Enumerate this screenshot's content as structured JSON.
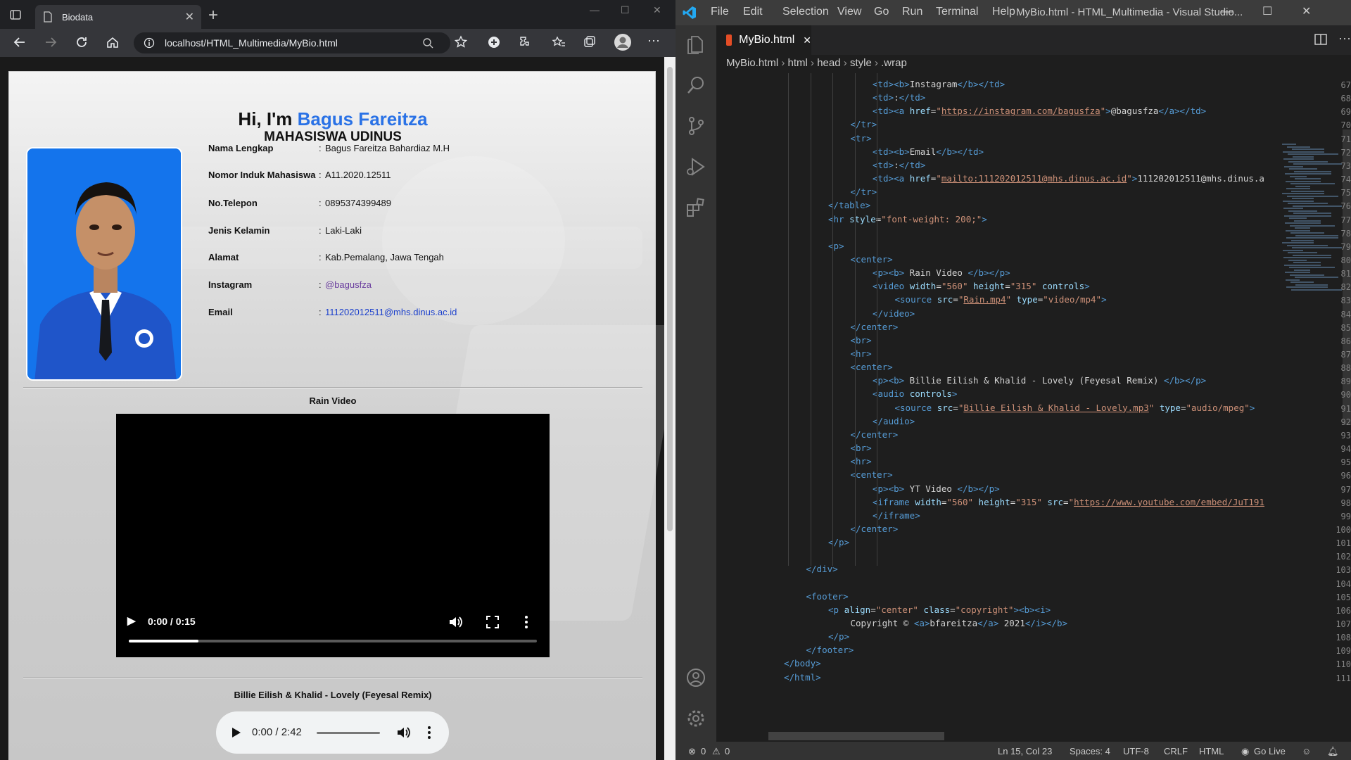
{
  "browser": {
    "tab_title": "Biodata",
    "url": "localhost/HTML_Multimedia/MyBio.html"
  },
  "page": {
    "greeting_prefix": "Hi, I'm ",
    "greeting_name": "Bagus Fareitza",
    "subtitle": "MAHASISWA UDINUS",
    "bio": [
      {
        "label": "Nama Lengkap",
        "value": "Bagus Fareitza Bahardiaz M.H"
      },
      {
        "label": "Nomor Induk Mahasiswa",
        "value": "A11.2020.12511"
      },
      {
        "label": "No.Telepon",
        "value": "0895374399489"
      },
      {
        "label": "Jenis Kelamin",
        "value": "Laki-Laki"
      },
      {
        "label": "Alamat",
        "value": "Kab.Pemalang, Jawa Tengah"
      },
      {
        "label": "Instagram",
        "value": "@bagusfza"
      },
      {
        "label": "Email",
        "value": "111202012511@mhs.dinus.ac.id"
      }
    ],
    "separator": ":",
    "video_title": "Rain Video",
    "video_time": "0:00 / 0:15",
    "video_progress": 0.17,
    "audio_title": "Billie Eilish & Khalid - Lovely (Feyesal Remix)",
    "audio_time": "0:00 / 2:42"
  },
  "vscode": {
    "menu": [
      "File",
      "Edit",
      "Selection",
      "View",
      "Go",
      "Run",
      "Terminal",
      "Help"
    ],
    "window_title": "MyBio.html - HTML_Multimedia - Visual Studio...",
    "editor_tab": "MyBio.html",
    "breadcrumbs": [
      "MyBio.html",
      "html",
      "head",
      "style",
      ".wrap"
    ],
    "lines": [
      {
        "n": "67",
        "i": 4,
        "t": [
          [
            "tg",
            "<td><b>"
          ],
          [
            "tx",
            "Instagram"
          ],
          [
            "tg",
            "</b></td>"
          ]
        ]
      },
      {
        "n": "68",
        "i": 4,
        "t": [
          [
            "tg",
            "<td>"
          ],
          [
            "tx",
            ":"
          ],
          [
            "tg",
            "</td>"
          ]
        ]
      },
      {
        "n": "69",
        "i": 4,
        "t": [
          [
            "tg",
            "<td><a "
          ],
          [
            "at",
            "href"
          ],
          [
            "tx",
            "="
          ],
          [
            "st",
            "\""
          ],
          [
            "stu",
            "https://instagram.com/bagusfza"
          ],
          [
            "st",
            "\""
          ],
          [
            "tg",
            ">"
          ],
          [
            "tx",
            "@bagusfza"
          ],
          [
            "tg",
            "</a></td>"
          ]
        ]
      },
      {
        "n": "70",
        "i": 3,
        "t": [
          [
            "tg",
            "</tr>"
          ]
        ]
      },
      {
        "n": "71",
        "i": 3,
        "t": [
          [
            "tg",
            "<tr>"
          ]
        ]
      },
      {
        "n": "72",
        "i": 4,
        "t": [
          [
            "tg",
            "<td><b>"
          ],
          [
            "tx",
            "Email"
          ],
          [
            "tg",
            "</b></td>"
          ]
        ]
      },
      {
        "n": "73",
        "i": 4,
        "t": [
          [
            "tg",
            "<td>"
          ],
          [
            "tx",
            ":"
          ],
          [
            "tg",
            "</td>"
          ]
        ]
      },
      {
        "n": "74",
        "i": 4,
        "t": [
          [
            "tg",
            "<td><a "
          ],
          [
            "at",
            "href"
          ],
          [
            "tx",
            "="
          ],
          [
            "st",
            "\""
          ],
          [
            "stu",
            "mailto:111202012511@mhs.dinus.ac.id"
          ],
          [
            "st",
            "\""
          ],
          [
            "tg",
            ">"
          ],
          [
            "tx",
            "111202012511@mhs.dinus.a"
          ]
        ]
      },
      {
        "n": "75",
        "i": 3,
        "t": [
          [
            "tg",
            "</tr>"
          ]
        ]
      },
      {
        "n": "76",
        "i": 2,
        "t": [
          [
            "tg",
            "</table>"
          ]
        ]
      },
      {
        "n": "77",
        "i": 2,
        "t": [
          [
            "tg",
            "<hr "
          ],
          [
            "at",
            "style"
          ],
          [
            "tx",
            "="
          ],
          [
            "st",
            "\"font-weight: 200;\""
          ],
          [
            "tg",
            ">"
          ]
        ]
      },
      {
        "n": "78",
        "i": 0,
        "t": []
      },
      {
        "n": "79",
        "i": 2,
        "t": [
          [
            "tg",
            "<p>"
          ]
        ]
      },
      {
        "n": "80",
        "i": 3,
        "t": [
          [
            "tg",
            "<center>"
          ]
        ]
      },
      {
        "n": "81",
        "i": 4,
        "t": [
          [
            "tg",
            "<p><b>"
          ],
          [
            "tx",
            " Rain Video "
          ],
          [
            "tg",
            "</b></p>"
          ]
        ]
      },
      {
        "n": "82",
        "i": 4,
        "t": [
          [
            "tg",
            "<video "
          ],
          [
            "at",
            "width"
          ],
          [
            "tx",
            "="
          ],
          [
            "st",
            "\"560\""
          ],
          [
            "at",
            " height"
          ],
          [
            "tx",
            "="
          ],
          [
            "st",
            "\"315\""
          ],
          [
            "at",
            " controls"
          ],
          [
            "tg",
            ">"
          ]
        ]
      },
      {
        "n": "83",
        "i": 5,
        "t": [
          [
            "tg",
            "<source "
          ],
          [
            "at",
            "src"
          ],
          [
            "tx",
            "="
          ],
          [
            "st",
            "\""
          ],
          [
            "stu",
            "Rain.mp4"
          ],
          [
            "st",
            "\""
          ],
          [
            "at",
            " type"
          ],
          [
            "tx",
            "="
          ],
          [
            "st",
            "\"video/mp4\""
          ],
          [
            "tg",
            ">"
          ]
        ]
      },
      {
        "n": "84",
        "i": 4,
        "t": [
          [
            "tg",
            "</video>"
          ]
        ]
      },
      {
        "n": "85",
        "i": 3,
        "t": [
          [
            "tg",
            "</center>"
          ]
        ]
      },
      {
        "n": "86",
        "i": 3,
        "t": [
          [
            "tg",
            "<br>"
          ]
        ]
      },
      {
        "n": "87",
        "i": 3,
        "t": [
          [
            "tg",
            "<hr>"
          ]
        ]
      },
      {
        "n": "88",
        "i": 3,
        "t": [
          [
            "tg",
            "<center>"
          ]
        ]
      },
      {
        "n": "89",
        "i": 4,
        "t": [
          [
            "tg",
            "<p><b>"
          ],
          [
            "tx",
            " Billie Eilish & Khalid - Lovely (Feyesal Remix) "
          ],
          [
            "tg",
            "</b></p>"
          ]
        ]
      },
      {
        "n": "90",
        "i": 4,
        "t": [
          [
            "tg",
            "<audio "
          ],
          [
            "at",
            "controls"
          ],
          [
            "tg",
            ">"
          ]
        ]
      },
      {
        "n": "91",
        "i": 5,
        "t": [
          [
            "tg",
            "<source "
          ],
          [
            "at",
            "src"
          ],
          [
            "tx",
            "="
          ],
          [
            "st",
            "\""
          ],
          [
            "stu",
            "Billie Eilish & Khalid - Lovely.mp3"
          ],
          [
            "st",
            "\""
          ],
          [
            "at",
            " type"
          ],
          [
            "tx",
            "="
          ],
          [
            "st",
            "\"audio/mpeg\""
          ],
          [
            "tg",
            ">"
          ]
        ]
      },
      {
        "n": "92",
        "i": 4,
        "t": [
          [
            "tg",
            "</audio>"
          ]
        ]
      },
      {
        "n": "93",
        "i": 3,
        "t": [
          [
            "tg",
            "</center>"
          ]
        ]
      },
      {
        "n": "94",
        "i": 3,
        "t": [
          [
            "tg",
            "<br>"
          ]
        ]
      },
      {
        "n": "95",
        "i": 3,
        "t": [
          [
            "tg",
            "<hr>"
          ]
        ]
      },
      {
        "n": "96",
        "i": 3,
        "t": [
          [
            "tg",
            "<center>"
          ]
        ]
      },
      {
        "n": "97",
        "i": 4,
        "t": [
          [
            "tg",
            "<p><b>"
          ],
          [
            "tx",
            " YT Video "
          ],
          [
            "tg",
            "</b></p>"
          ]
        ]
      },
      {
        "n": "98",
        "i": 4,
        "t": [
          [
            "tg",
            "<iframe "
          ],
          [
            "at",
            "width"
          ],
          [
            "tx",
            "="
          ],
          [
            "st",
            "\"560\""
          ],
          [
            "at",
            " height"
          ],
          [
            "tx",
            "="
          ],
          [
            "st",
            "\"315\""
          ],
          [
            "at",
            " src"
          ],
          [
            "tx",
            "="
          ],
          [
            "st",
            "\""
          ],
          [
            "stu",
            "https://www.youtube.com/embed/JuT191"
          ]
        ]
      },
      {
        "n": "99",
        "i": 4,
        "t": [
          [
            "tg",
            "</iframe>"
          ]
        ]
      },
      {
        "n": "100",
        "i": 3,
        "t": [
          [
            "tg",
            "</center>"
          ]
        ]
      },
      {
        "n": "101",
        "i": 2,
        "t": [
          [
            "tg",
            "</p>"
          ]
        ]
      },
      {
        "n": "102",
        "i": 0,
        "t": []
      },
      {
        "n": "103",
        "i": 1,
        "t": [
          [
            "tg",
            "</div>"
          ]
        ]
      },
      {
        "n": "104",
        "i": 0,
        "t": []
      },
      {
        "n": "105",
        "i": 1,
        "t": [
          [
            "tg",
            "<footer>"
          ]
        ]
      },
      {
        "n": "106",
        "i": 2,
        "t": [
          [
            "tg",
            "<p "
          ],
          [
            "at",
            "align"
          ],
          [
            "tx",
            "="
          ],
          [
            "st",
            "\"center\""
          ],
          [
            "at",
            " class"
          ],
          [
            "tx",
            "="
          ],
          [
            "st",
            "\"copyright\""
          ],
          [
            "tg",
            "><b><i>"
          ]
        ]
      },
      {
        "n": "107",
        "i": 3,
        "t": [
          [
            "tx",
            "Copyright © "
          ],
          [
            "tg",
            "<a>"
          ],
          [
            "tx",
            "bfareitza"
          ],
          [
            "tg",
            "</a>"
          ],
          [
            "tx",
            " 2021"
          ],
          [
            "tg",
            "</i></b>"
          ]
        ]
      },
      {
        "n": "108",
        "i": 2,
        "t": [
          [
            "tg",
            "</p>"
          ]
        ]
      },
      {
        "n": "109",
        "i": 1,
        "t": [
          [
            "tg",
            "</footer>"
          ]
        ]
      },
      {
        "n": "110",
        "i": 0,
        "t": [
          [
            "tg",
            "</body>"
          ]
        ]
      },
      {
        "n": "111",
        "i": 0,
        "t": [
          [
            "tg",
            "</html>"
          ]
        ]
      }
    ],
    "status": {
      "errors": "0",
      "warnings": "0",
      "cursor": "Ln 15, Col 23",
      "spaces": "Spaces: 4",
      "encoding": "UTF-8",
      "eol": "CRLF",
      "language": "HTML",
      "golive": "Go Live"
    }
  }
}
